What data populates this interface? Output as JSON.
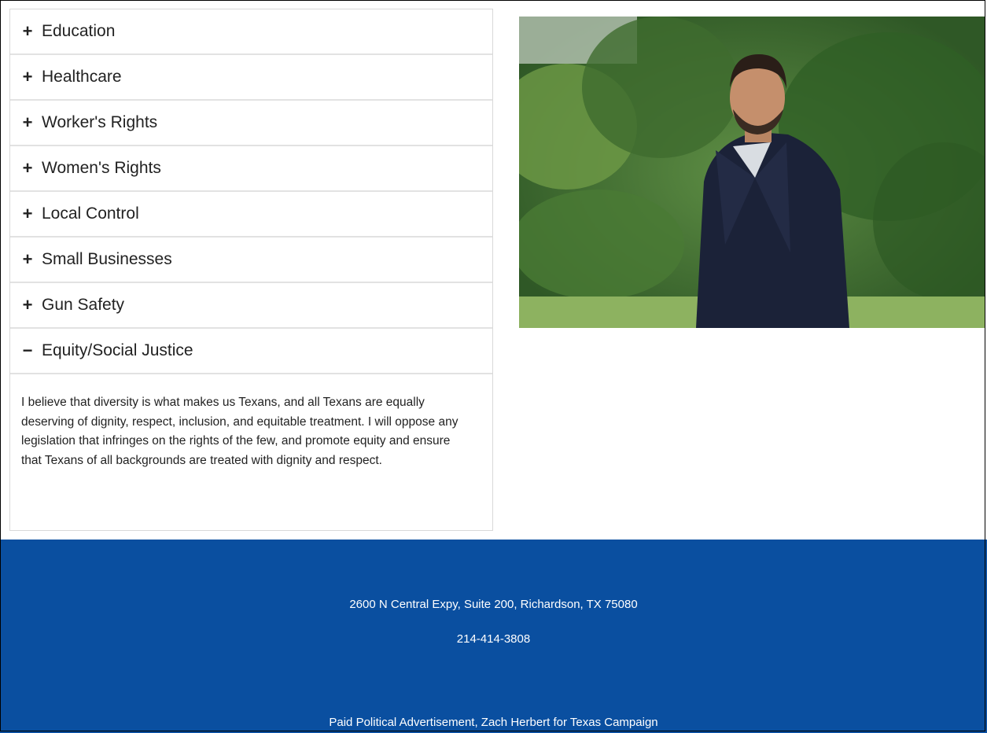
{
  "accordion": {
    "items": [
      {
        "sign": "+",
        "title": "Education"
      },
      {
        "sign": "+",
        "title": "Healthcare"
      },
      {
        "sign": "+",
        "title": "Worker's Rights"
      },
      {
        "sign": "+",
        "title": "Women's Rights"
      },
      {
        "sign": "+",
        "title": "Local Control"
      },
      {
        "sign": "+",
        "title": "Small Businesses"
      },
      {
        "sign": "+",
        "title": "Gun Safety"
      },
      {
        "sign": "−",
        "title": "Equity/Social Justice"
      }
    ],
    "expanded_body": "I believe that diversity is what makes us Texans, and all Texans are equally deserving of dignity, respect, inclusion, and equitable treatment. I will oppose any legislation that infringes on the rights of the few, and promote equity and ensure that Texans of all backgrounds are treated with dignity and respect."
  },
  "photo": {
    "icon": "candidate-portrait"
  },
  "footer": {
    "address": "2600 N Central Expy, Suite 200, Richardson, TX 75080",
    "phone": "214-414-3808",
    "disclaimer": "Paid Political Advertisement, Zach Herbert for Texas Campaign",
    "background_color": "#0a4fa0"
  }
}
